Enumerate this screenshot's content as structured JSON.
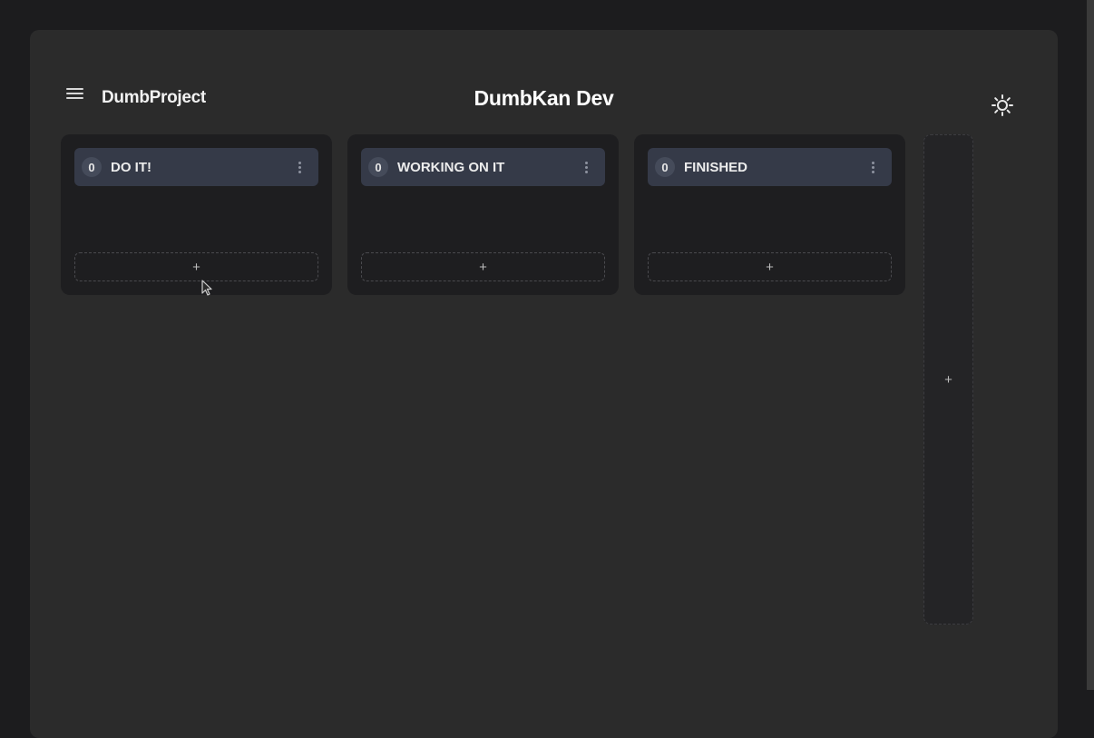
{
  "header": {
    "project_name": "DumbProject",
    "board_title": "DumbKan Dev",
    "menu_icon": "hamburger-icon",
    "theme_icon": "sun-icon"
  },
  "columns": [
    {
      "title": "DO IT!",
      "count": "0",
      "add_label": "+"
    },
    {
      "title": "WORKING ON IT",
      "count": "0",
      "add_label": "+"
    },
    {
      "title": "FINISHED",
      "count": "0",
      "add_label": "+"
    }
  ],
  "add_column": {
    "label": "+"
  },
  "colors": {
    "background": "#1c1c1e",
    "app_surface": "#2b2b2b",
    "column_bg": "#1e1e20",
    "column_header": "#353a48"
  }
}
